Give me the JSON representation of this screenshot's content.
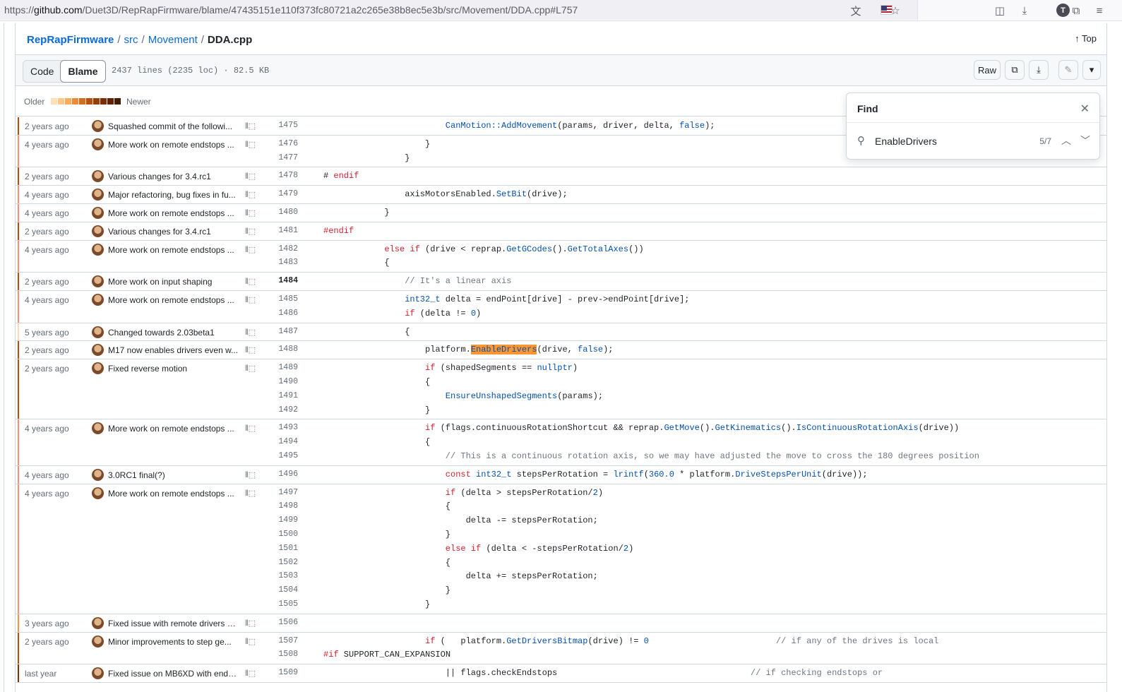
{
  "browser": {
    "url_prefix": "https://",
    "url_domain": "github.com",
    "url_path": "/Duet3D/RepRapFirmware/blame/47435151e110f373fc80721a2c265e38b8ec5e3b/src/Movement/DDA.cpp#L757",
    "account_initial": "T"
  },
  "breadcrumb": {
    "repo": "RepRapFirmware",
    "sep1": "/",
    "dir1": "src",
    "sep2": "/",
    "dir2": "Movement",
    "sep3": "/",
    "file": "DDA.cpp"
  },
  "top_label": "Top",
  "toolbar": {
    "code_tab": "Code",
    "blame_tab": "Blame",
    "file_info": "2437 lines (2235 loc) · 82.5 KB",
    "raw_label": "Raw"
  },
  "legend": {
    "older": "Older",
    "newer": "Newer",
    "colors": [
      "#ffdfb6",
      "#fdc68c",
      "#f8ac5e",
      "#ed8c36",
      "#d46d1f",
      "#b7520e",
      "#953e06",
      "#7a2e04",
      "#5f2302",
      "#451a02"
    ]
  },
  "find": {
    "title": "Find",
    "query": "EnableDrivers",
    "count": "5/7"
  },
  "blame_rows": [
    {
      "age": "2 years ago",
      "msg": "Squashed commit of the followi...",
      "color": "#bc4c00",
      "lines": [
        {
          "n": "1475",
          "indent": 24,
          "parts": [
            {
              "t": "CanMotion::AddMovement",
              "c": "f"
            },
            {
              "t": "(params, driver, delta, "
            },
            {
              "t": "false",
              "c": "f"
            },
            {
              "t": ");"
            }
          ]
        }
      ]
    },
    {
      "age": "4 years ago",
      "msg": "More work on remote endstops ...",
      "color": "#fd8c73",
      "lines": [
        {
          "n": "1476",
          "indent": 20,
          "parts": [
            {
              "t": "}"
            }
          ]
        },
        {
          "n": "1477",
          "indent": 16,
          "parts": [
            {
              "t": "}"
            }
          ]
        }
      ]
    },
    {
      "age": "2 years ago",
      "msg": "Various changes for 3.4.rc1",
      "color": "#bc4c00",
      "lines": [
        {
          "n": "1478",
          "indent": 0,
          "parts": [
            {
              "t": "# "
            },
            {
              "t": "endif",
              "c": "k"
            }
          ]
        }
      ]
    },
    {
      "age": "4 years ago",
      "msg": "Major refactoring, bug fixes in fu...",
      "color": "#fd8c73",
      "lines": [
        {
          "n": "1479",
          "indent": 16,
          "parts": [
            {
              "t": "axisMotorsEnabled."
            },
            {
              "t": "SetBit",
              "c": "f"
            },
            {
              "t": "(drive);"
            }
          ]
        }
      ]
    },
    {
      "age": "4 years ago",
      "msg": "More work on remote endstops ...",
      "color": "#fd8c73",
      "lines": [
        {
          "n": "1480",
          "indent": 12,
          "parts": [
            {
              "t": "}"
            }
          ]
        }
      ]
    },
    {
      "age": "2 years ago",
      "msg": "Various changes for 3.4.rc1",
      "color": "#bc4c00",
      "lines": [
        {
          "n": "1481",
          "indent": 0,
          "parts": [
            {
              "t": "#endif",
              "c": "k"
            }
          ]
        }
      ]
    },
    {
      "age": "4 years ago",
      "msg": "More work on remote endstops ...",
      "color": "#fd8c73",
      "lines": [
        {
          "n": "1482",
          "indent": 12,
          "parts": [
            {
              "t": "else if",
              "c": "k"
            },
            {
              "t": " (drive < reprap."
            },
            {
              "t": "GetGCodes",
              "c": "f"
            },
            {
              "t": "()."
            },
            {
              "t": "GetTotalAxes",
              "c": "f"
            },
            {
              "t": "())"
            }
          ]
        },
        {
          "n": "1483",
          "indent": 12,
          "parts": [
            {
              "t": "{"
            }
          ]
        }
      ]
    },
    {
      "age": "2 years ago",
      "msg": "More work on input shaping",
      "color": "#bc4c00",
      "lines": [
        {
          "n": "1484",
          "indent": 16,
          "cur": true,
          "parts": [
            {
              "t": "// It's a linear axis",
              "c": "c"
            }
          ]
        }
      ]
    },
    {
      "age": "4 years ago",
      "msg": "More work on remote endstops ...",
      "color": "#fd8c73",
      "lines": [
        {
          "n": "1485",
          "indent": 16,
          "parts": [
            {
              "t": "int32_t",
              "c": "f"
            },
            {
              "t": " delta = endPoint[drive] - prev->endPoint[drive];"
            }
          ]
        },
        {
          "n": "1486",
          "indent": 16,
          "parts": [
            {
              "t": "if",
              "c": "k"
            },
            {
              "t": " (delta != "
            },
            {
              "t": "0",
              "c": "f"
            },
            {
              "t": ")"
            }
          ]
        }
      ]
    },
    {
      "age": "5 years ago",
      "msg": "Changed towards 2.03beta1",
      "color": "#ffd8b5",
      "lines": [
        {
          "n": "1487",
          "indent": 16,
          "parts": [
            {
              "t": "{"
            }
          ]
        }
      ]
    },
    {
      "age": "2 years ago",
      "msg": "M17 now enables drivers even w...",
      "color": "#bc4c00",
      "lines": [
        {
          "n": "1488",
          "indent": 20,
          "parts": [
            {
              "t": "platform."
            },
            {
              "t": "EnableDrivers",
              "c": "hl"
            },
            {
              "t": "(drive, "
            },
            {
              "t": "false",
              "c": "f"
            },
            {
              "t": ");"
            }
          ]
        }
      ]
    },
    {
      "age": "2 years ago",
      "msg": "Fixed reverse motion",
      "color": "#bc4c00",
      "lines": [
        {
          "n": "1489",
          "indent": 20,
          "parts": [
            {
              "t": "if",
              "c": "k"
            },
            {
              "t": " (shapedSegments == "
            },
            {
              "t": "nullptr",
              "c": "f"
            },
            {
              "t": ")"
            }
          ]
        },
        {
          "n": "1490",
          "indent": 20,
          "parts": [
            {
              "t": "{"
            }
          ]
        },
        {
          "n": "1491",
          "indent": 24,
          "parts": [
            {
              "t": "EnsureUnshapedSegments",
              "c": "f"
            },
            {
              "t": "(params);"
            }
          ]
        },
        {
          "n": "1492",
          "indent": 20,
          "parts": [
            {
              "t": "}"
            }
          ]
        }
      ]
    },
    {
      "age": "4 years ago",
      "msg": "More work on remote endstops ...",
      "color": "#fd8c73",
      "lines": [
        {
          "n": "1493",
          "indent": 20,
          "parts": [
            {
              "t": "if",
              "c": "k"
            },
            {
              "t": " (flags.continuousRotationShortcut && reprap."
            },
            {
              "t": "GetMove",
              "c": "f"
            },
            {
              "t": "()."
            },
            {
              "t": "GetKinematics",
              "c": "f"
            },
            {
              "t": "()."
            },
            {
              "t": "IsContinuousRotationAxis",
              "c": "f"
            },
            {
              "t": "(drive))"
            }
          ]
        },
        {
          "n": "1494",
          "indent": 20,
          "parts": [
            {
              "t": "{"
            }
          ]
        },
        {
          "n": "1495",
          "indent": 24,
          "parts": [
            {
              "t": "// This is a continuous rotation axis, so we may have adjusted the move to cross the 180 degrees position",
              "c": "c"
            }
          ]
        }
      ]
    },
    {
      "age": "4 years ago",
      "msg": "3.0RC1 final(?)",
      "color": "#fd8c73",
      "lines": [
        {
          "n": "1496",
          "indent": 24,
          "parts": [
            {
              "t": "const",
              "c": "k"
            },
            {
              "t": " "
            },
            {
              "t": "int32_t",
              "c": "f"
            },
            {
              "t": " stepsPerRotation = "
            },
            {
              "t": "lrintf",
              "c": "f"
            },
            {
              "t": "("
            },
            {
              "t": "360.0",
              "c": "f"
            },
            {
              "t": " * platform."
            },
            {
              "t": "DriveStepsPerUnit",
              "c": "f"
            },
            {
              "t": "(drive));"
            }
          ]
        }
      ]
    },
    {
      "age": "4 years ago",
      "msg": "More work on remote endstops ...",
      "color": "#fd8c73",
      "lines": [
        {
          "n": "1497",
          "indent": 24,
          "parts": [
            {
              "t": "if",
              "c": "k"
            },
            {
              "t": " (delta > stepsPerRotation/"
            },
            {
              "t": "2",
              "c": "f"
            },
            {
              "t": ")"
            }
          ]
        },
        {
          "n": "1498",
          "indent": 24,
          "parts": [
            {
              "t": "{"
            }
          ]
        },
        {
          "n": "1499",
          "indent": 28,
          "parts": [
            {
              "t": "delta -= stepsPerRotation;"
            }
          ]
        },
        {
          "n": "1500",
          "indent": 24,
          "parts": [
            {
              "t": "}"
            }
          ]
        },
        {
          "n": "1501",
          "indent": 24,
          "parts": [
            {
              "t": "else if",
              "c": "k"
            },
            {
              "t": " (delta < -stepsPerRotation/"
            },
            {
              "t": "2",
              "c": "f"
            },
            {
              "t": ")"
            }
          ]
        },
        {
          "n": "1502",
          "indent": 24,
          "parts": [
            {
              "t": "{"
            }
          ]
        },
        {
          "n": "1503",
          "indent": 28,
          "parts": [
            {
              "t": "delta += stepsPerRotation;"
            }
          ]
        },
        {
          "n": "1504",
          "indent": 24,
          "parts": [
            {
              "t": "}"
            }
          ]
        },
        {
          "n": "1505",
          "indent": 20,
          "parts": [
            {
              "t": "}"
            }
          ]
        }
      ]
    },
    {
      "age": "3 years ago",
      "msg": "Fixed issue with remote drivers n...",
      "color": "#fb8f44",
      "lines": [
        {
          "n": "1506",
          "indent": 0,
          "parts": [
            {
              "t": ""
            }
          ]
        }
      ]
    },
    {
      "age": "2 years ago",
      "msg": "Minor improvements to step ge...",
      "color": "#bc4c00",
      "lines": [
        {
          "n": "1507",
          "indent": 20,
          "parts": [
            {
              "t": "if",
              "c": "k"
            },
            {
              "t": " (   platform."
            },
            {
              "t": "GetDriversBitmap",
              "c": "f"
            },
            {
              "t": "(drive) != "
            },
            {
              "t": "0",
              "c": "f"
            },
            {
              "t": "                         "
            },
            {
              "t": "// if any of the drives is local",
              "c": "c"
            }
          ]
        },
        {
          "n": "1508",
          "indent": 0,
          "parts": [
            {
              "t": "#if",
              "c": "k"
            },
            {
              "t": " SUPPORT_CAN_EXPANSION"
            }
          ]
        }
      ]
    },
    {
      "age": "last year",
      "msg": "Fixed issue on MB6XD with ends...",
      "color": "#8a3000",
      "lines": [
        {
          "n": "1509",
          "indent": 24,
          "parts": [
            {
              "t": "|| flags.checkEndstops                                      "
            },
            {
              "t": "// if checking endstops or",
              "c": "c"
            }
          ]
        }
      ]
    }
  ]
}
